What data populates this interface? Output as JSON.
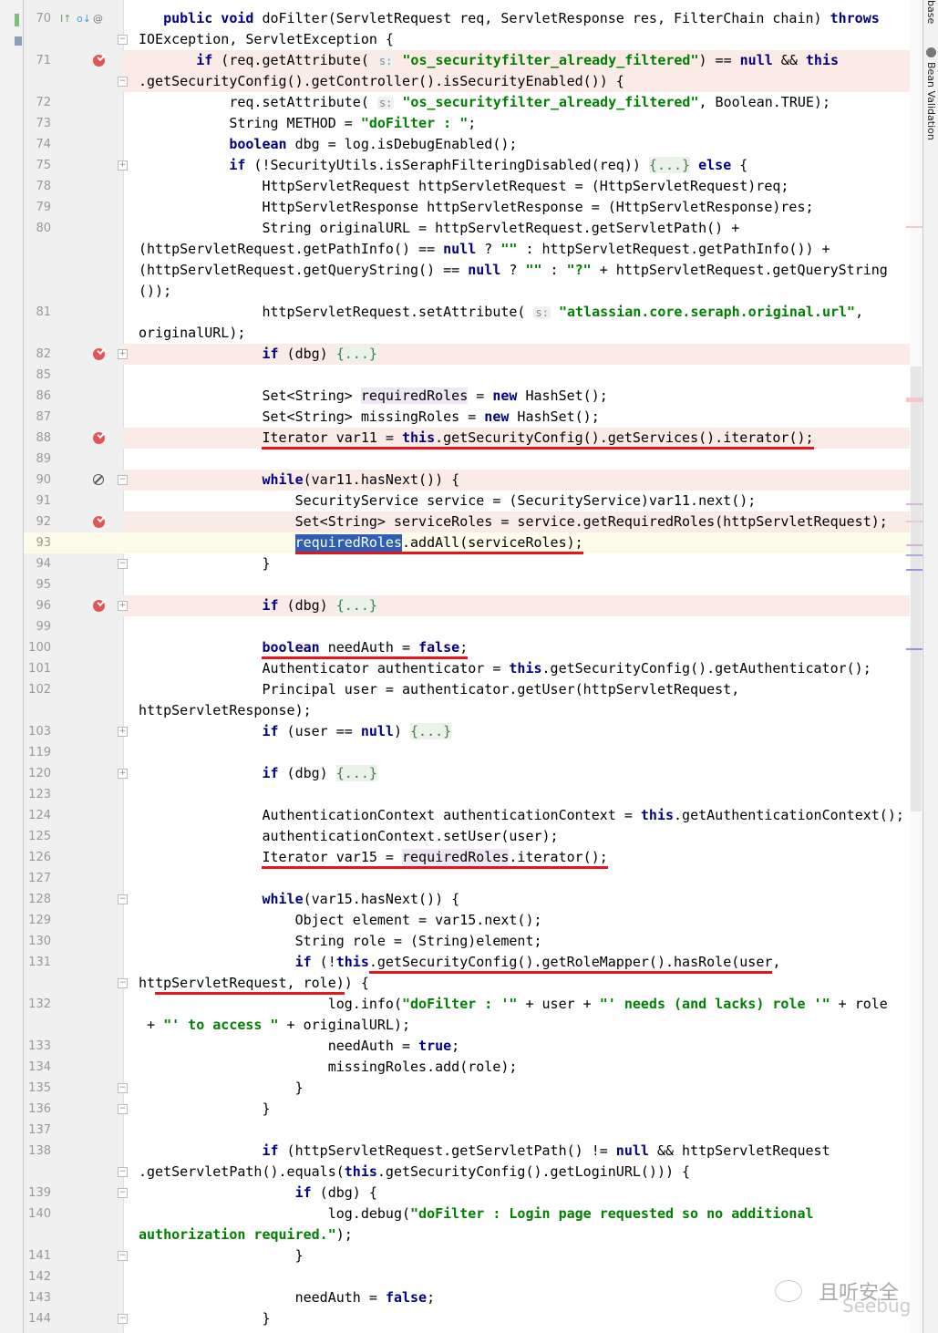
{
  "right_panel": {
    "tab_top": "base",
    "tab_bean": "Bean Validation",
    "bean_icon": "bean-validation-icon"
  },
  "watermark": {
    "text_cn": "且听安全",
    "text_en": "Seebug",
    "icon": "wechat-icon"
  },
  "colors": {
    "breakpoint": "#e05555",
    "breakpoint_line": "#faebe7",
    "current_line": "#fdfce8",
    "keyword": "#000080",
    "string": "#008000",
    "annotation_underline": "#e8141c",
    "selection": "#2f5fb3"
  },
  "rows": [
    {
      "n": "70",
      "icon": "override-icons",
      "t": [
        [
          "p",
          "   "
        ],
        [
          "k",
          "public void"
        ],
        [
          "p",
          " doFilter(ServletRequest req, ServletResponse res, FilterChain chain) "
        ],
        [
          "k",
          "throws"
        ]
      ]
    },
    {
      "n": "",
      "fold": "open",
      "t": [
        [
          "p",
          "IOException, ServletException {"
        ]
      ]
    },
    {
      "n": "71",
      "icon": "bp",
      "bg": "bp",
      "t": [
        [
          "p",
          "       "
        ],
        [
          "k",
          "if"
        ],
        [
          "p",
          " (req.getAttribute( "
        ],
        [
          "h",
          "s:"
        ],
        [
          "p",
          " "
        ],
        [
          "s",
          "\"os_securityfilter_already_filtered\""
        ],
        [
          "p",
          ") == "
        ],
        [
          "k",
          "null"
        ],
        [
          "p",
          " && "
        ],
        [
          "k",
          "this"
        ]
      ]
    },
    {
      "n": "",
      "fold": "close",
      "bg": "bp",
      "t": [
        [
          "p",
          ".getSecurityConfig().getController().isSecurityEnabled()) {"
        ]
      ]
    },
    {
      "n": "72",
      "t": [
        [
          "p",
          "           req.setAttribute( "
        ],
        [
          "h",
          "s:"
        ],
        [
          "p",
          " "
        ],
        [
          "s",
          "\"os_securityfilter_already_filtered\""
        ],
        [
          "p",
          ", Boolean.TRUE);"
        ]
      ]
    },
    {
      "n": "73",
      "t": [
        [
          "p",
          "           String METHOD = "
        ],
        [
          "s",
          "\"doFilter : \""
        ],
        [
          "p",
          ";"
        ]
      ]
    },
    {
      "n": "74",
      "t": [
        [
          "p",
          "           "
        ],
        [
          "k",
          "boolean"
        ],
        [
          "p",
          " dbg = log.isDebugEnabled();"
        ]
      ]
    },
    {
      "n": "75",
      "fold": "plus",
      "t": [
        [
          "p",
          "           "
        ],
        [
          "k",
          "if"
        ],
        [
          "p",
          " (!SecurityUtils.isSeraphFilteringDisabled(req)) "
        ],
        [
          "f",
          "{...}"
        ],
        [
          "p",
          " "
        ],
        [
          "k",
          "else"
        ],
        [
          "p",
          " {"
        ]
      ]
    },
    {
      "n": "78",
      "t": [
        [
          "p",
          "               HttpServletRequest httpServletRequest = (HttpServletRequest)req;"
        ]
      ]
    },
    {
      "n": "79",
      "t": [
        [
          "p",
          "               HttpServletResponse httpServletResponse = (HttpServletResponse)res;"
        ]
      ]
    },
    {
      "n": "80",
      "t": [
        [
          "p",
          "               String originalURL = httpServletRequest.getServletPath() +"
        ]
      ]
    },
    {
      "n": "",
      "t": [
        [
          "p",
          "(httpServletRequest.getPathInfo() == "
        ],
        [
          "k",
          "null"
        ],
        [
          "p",
          " ? "
        ],
        [
          "s",
          "\"\""
        ],
        [
          "p",
          " : httpServletRequest.getPathInfo()) +"
        ]
      ]
    },
    {
      "n": "",
      "t": [
        [
          "p",
          "(httpServletRequest.getQueryString() == "
        ],
        [
          "k",
          "null"
        ],
        [
          "p",
          " ? "
        ],
        [
          "s",
          "\"\""
        ],
        [
          "p",
          " : "
        ],
        [
          "s",
          "\"?\""
        ],
        [
          "p",
          " + httpServletRequest.getQueryString"
        ]
      ]
    },
    {
      "n": "",
      "t": [
        [
          "p",
          "());"
        ]
      ]
    },
    {
      "n": "81",
      "t": [
        [
          "p",
          "               httpServletRequest.setAttribute( "
        ],
        [
          "h",
          "s:"
        ],
        [
          "p",
          " "
        ],
        [
          "s",
          "\"atlassian.core.seraph.original.url\""
        ],
        [
          "p",
          ","
        ]
      ]
    },
    {
      "n": "",
      "t": [
        [
          "p",
          "originalURL);"
        ]
      ]
    },
    {
      "n": "82",
      "icon": "bp",
      "fold": "plus",
      "bg": "bp",
      "t": [
        [
          "p",
          "               "
        ],
        [
          "k",
          "if"
        ],
        [
          "p",
          " (dbg) "
        ],
        [
          "f",
          "{...}"
        ]
      ]
    },
    {
      "n": "85",
      "t": []
    },
    {
      "n": "86",
      "t": [
        [
          "p",
          "               Set<String> "
        ],
        [
          "hl",
          "requiredRoles"
        ],
        [
          "p",
          " = "
        ],
        [
          "k",
          "new"
        ],
        [
          "p",
          " HashSet();"
        ]
      ]
    },
    {
      "n": "87",
      "t": [
        [
          "p",
          "               Set<String> missingRoles = "
        ],
        [
          "k",
          "new"
        ],
        [
          "p",
          " HashSet();"
        ]
      ]
    },
    {
      "n": "88",
      "icon": "bp",
      "bg": "bp",
      "t": [
        [
          "p",
          "               "
        ],
        [
          "p u",
          "Iterator var11 = "
        ],
        [
          "k u",
          "this"
        ],
        [
          "p u",
          ".getSecurityConfig().getServices().iterator();"
        ]
      ]
    },
    {
      "n": "89",
      "t": []
    },
    {
      "n": "90",
      "icon": "bpoff",
      "fold": "open",
      "bg": "bp",
      "t": [
        [
          "p",
          "               "
        ],
        [
          "k",
          "while"
        ],
        [
          "p",
          "(var11.hasNext()) {"
        ]
      ]
    },
    {
      "n": "91",
      "t": [
        [
          "p",
          "                   SecurityService service = (SecurityService)var11.next();"
        ]
      ]
    },
    {
      "n": "92",
      "icon": "bp",
      "bg": "bp",
      "t": [
        [
          "p",
          "                   Set<String> serviceRoles = service.getRequiredRoles(httpServletRequest);"
        ]
      ]
    },
    {
      "n": "93",
      "bg": "cur",
      "t": [
        [
          "p",
          "                   "
        ],
        [
          "sel u",
          "requiredRoles"
        ],
        [
          "p u",
          ".addAll(serviceRoles);"
        ]
      ]
    },
    {
      "n": "94",
      "fold": "close",
      "t": [
        [
          "p",
          "               }"
        ]
      ]
    },
    {
      "n": "95",
      "t": []
    },
    {
      "n": "96",
      "icon": "bp",
      "fold": "plus",
      "bg": "bp",
      "t": [
        [
          "p",
          "               "
        ],
        [
          "k",
          "if"
        ],
        [
          "p",
          " (dbg) "
        ],
        [
          "f",
          "{...}"
        ]
      ]
    },
    {
      "n": "99",
      "t": []
    },
    {
      "n": "100",
      "t": [
        [
          "p",
          "               "
        ],
        [
          "k u",
          "boolean"
        ],
        [
          "p u",
          " needAuth = "
        ],
        [
          "k u",
          "false"
        ],
        [
          "p u",
          ";"
        ]
      ]
    },
    {
      "n": "101",
      "t": [
        [
          "p",
          "               Authenticator authenticator = "
        ],
        [
          "k",
          "this"
        ],
        [
          "p",
          ".getSecurityConfig().getAuthenticator();"
        ]
      ]
    },
    {
      "n": "102",
      "t": [
        [
          "p",
          "               Principal user = authenticator.getUser(httpServletRequest,"
        ]
      ]
    },
    {
      "n": "",
      "t": [
        [
          "p",
          "httpServletResponse);"
        ]
      ]
    },
    {
      "n": "103",
      "fold": "plus",
      "t": [
        [
          "p",
          "               "
        ],
        [
          "k",
          "if"
        ],
        [
          "p",
          " (user == "
        ],
        [
          "k",
          "null"
        ],
        [
          "p",
          ") "
        ],
        [
          "f",
          "{...}"
        ]
      ]
    },
    {
      "n": "119",
      "t": []
    },
    {
      "n": "120",
      "fold": "plus",
      "t": [
        [
          "p",
          "               "
        ],
        [
          "k",
          "if"
        ],
        [
          "p",
          " (dbg) "
        ],
        [
          "f",
          "{...}"
        ]
      ]
    },
    {
      "n": "123",
      "t": []
    },
    {
      "n": "124",
      "t": [
        [
          "p",
          "               AuthenticationContext authenticationContext = "
        ],
        [
          "k",
          "this"
        ],
        [
          "p",
          ".getAuthenticationContext();"
        ]
      ]
    },
    {
      "n": "125",
      "t": [
        [
          "p",
          "               authenticationContext.setUser(user);"
        ]
      ]
    },
    {
      "n": "126",
      "t": [
        [
          "p",
          "               "
        ],
        [
          "p u",
          "Iterator var15 = "
        ],
        [
          "hl u",
          "requiredRoles"
        ],
        [
          "p u",
          ".iterator();"
        ]
      ]
    },
    {
      "n": "127",
      "t": []
    },
    {
      "n": "128",
      "fold": "open",
      "t": [
        [
          "p",
          "               "
        ],
        [
          "k",
          "while"
        ],
        [
          "p",
          "(var15.hasNext()) {"
        ]
      ]
    },
    {
      "n": "129",
      "t": [
        [
          "p",
          "                   Object element = var15.next();"
        ]
      ]
    },
    {
      "n": "130",
      "t": [
        [
          "p",
          "                   String role = (String)element;"
        ]
      ]
    },
    {
      "n": "131",
      "t": [
        [
          "p",
          "                   "
        ],
        [
          "k",
          "if"
        ],
        [
          "p",
          " (!"
        ],
        [
          "k",
          "this"
        ],
        [
          "p u",
          ".getSecurityConfig().getRoleMapper().hasRole(user"
        ],
        [
          "p",
          ","
        ]
      ]
    },
    {
      "n": "",
      "fold": "open",
      "t": [
        [
          "p",
          "ht"
        ],
        [
          "p u",
          "tpServletRequest, role)"
        ],
        [
          "p",
          ") {"
        ]
      ]
    },
    {
      "n": "132",
      "t": [
        [
          "p",
          "                       log.info("
        ],
        [
          "s",
          "\"doFilter : '\""
        ],
        [
          "p",
          " + user + "
        ],
        [
          "s",
          "\"' needs (and lacks) role '\""
        ],
        [
          "p",
          " + role"
        ]
      ]
    },
    {
      "n": "",
      "t": [
        [
          "p",
          " + "
        ],
        [
          "s",
          "\"' to access \""
        ],
        [
          "p",
          " + originalURL);"
        ]
      ]
    },
    {
      "n": "133",
      "t": [
        [
          "p",
          "                       needAuth = "
        ],
        [
          "k",
          "true"
        ],
        [
          "p",
          ";"
        ]
      ]
    },
    {
      "n": "134",
      "t": [
        [
          "p",
          "                       missingRoles.add(role);"
        ]
      ]
    },
    {
      "n": "135",
      "fold": "close",
      "t": [
        [
          "p",
          "                   }"
        ]
      ]
    },
    {
      "n": "136",
      "fold": "close",
      "t": [
        [
          "p",
          "               }"
        ]
      ]
    },
    {
      "n": "137",
      "t": []
    },
    {
      "n": "138",
      "t": [
        [
          "p",
          "               "
        ],
        [
          "k",
          "if"
        ],
        [
          "p",
          " (httpServletRequest.getServletPath() != "
        ],
        [
          "k",
          "null"
        ],
        [
          "p",
          " && httpServletRequest"
        ]
      ]
    },
    {
      "n": "",
      "fold": "open",
      "t": [
        [
          "p",
          ".getServletPath().equals("
        ],
        [
          "k",
          "this"
        ],
        [
          "p",
          ".getSecurityConfig().getLoginURL())) {"
        ]
      ]
    },
    {
      "n": "139",
      "fold": "open",
      "t": [
        [
          "p",
          "                   "
        ],
        [
          "k",
          "if"
        ],
        [
          "p",
          " (dbg) {"
        ]
      ]
    },
    {
      "n": "140",
      "t": [
        [
          "p",
          "                       log.debug("
        ],
        [
          "s",
          "\"doFilter : Login page requested so no additional"
        ]
      ]
    },
    {
      "n": "",
      "t": [
        [
          "s",
          "authorization required.\""
        ],
        [
          "p",
          ");"
        ]
      ]
    },
    {
      "n": "141",
      "fold": "close",
      "t": [
        [
          "p",
          "                   }"
        ]
      ]
    },
    {
      "n": "142",
      "t": []
    },
    {
      "n": "143",
      "t": [
        [
          "p",
          "                   needAuth = "
        ],
        [
          "k",
          "false"
        ],
        [
          "p",
          ";"
        ]
      ]
    },
    {
      "n": "144",
      "fold": "close",
      "t": [
        [
          "p",
          "               }"
        ]
      ]
    }
  ]
}
